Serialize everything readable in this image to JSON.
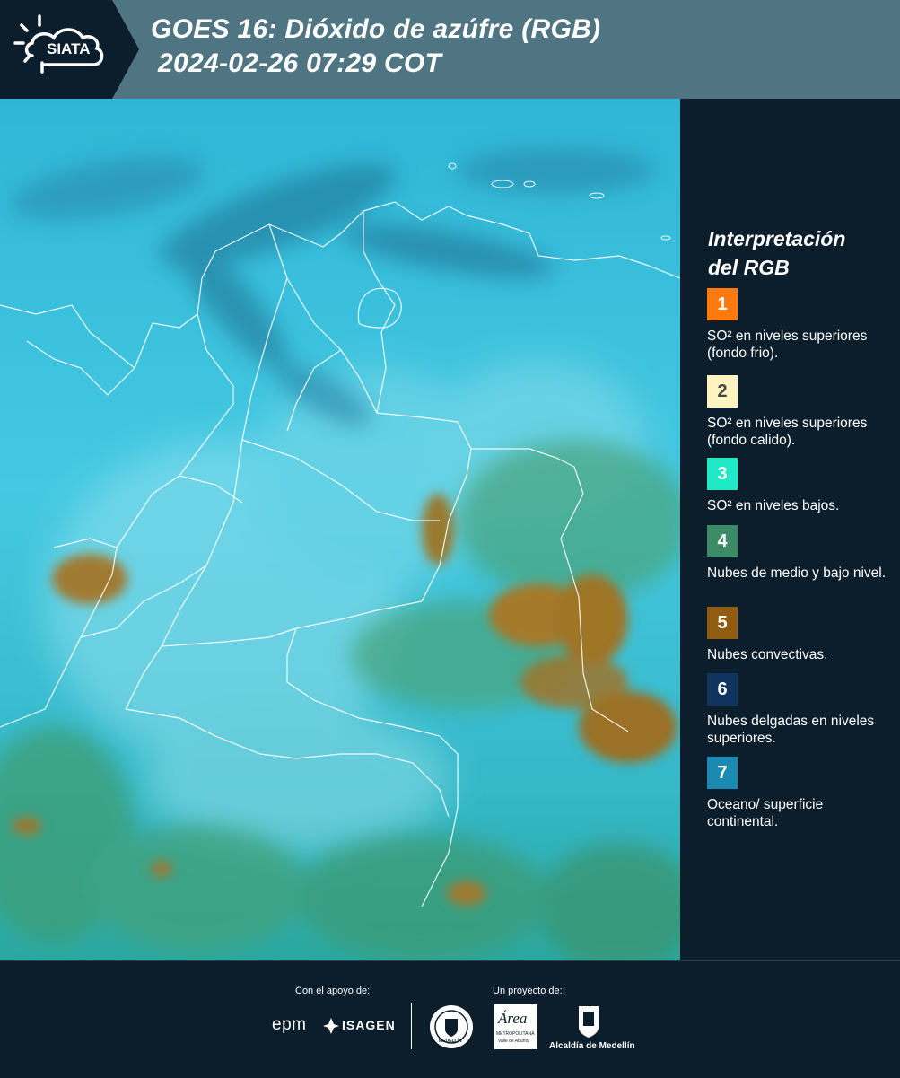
{
  "header": {
    "logo_text": "SIATA",
    "title_line1": "GOES 16: Dióxido de azúfre (RGB)",
    "title_line2": "2024-02-26 07:29 COT",
    "background": "#4f7482",
    "logo_background": "#0c1e2b"
  },
  "map": {
    "icon": "satellite-rgb-map",
    "colors": {
      "clear": "#33c3df",
      "thin": "#7cd9ea",
      "convective": "#a97b2a",
      "low_cloud": "#3f9a6e",
      "borders": "#ffffff"
    }
  },
  "legend": {
    "title_line1": "Interpretación",
    "title_line2": "del RGB",
    "items": [
      {
        "num": "1",
        "color": "#ff7a0e",
        "text_color": "#ffffff",
        "label": "SO² en niveles superiores (fondo frio)."
      },
      {
        "num": "2",
        "color": "#fff4c0",
        "text_color": "#444444",
        "label": "SO² en niveles superiores (fondo calido)."
      },
      {
        "num": "3",
        "color": "#1fe8c6",
        "text_color": "#ffffff",
        "label": "SO² en niveles bajos."
      },
      {
        "num": "4",
        "color": "#3a8b66",
        "text_color": "#ffffff",
        "label": "Nubes de medio y bajo nivel."
      },
      {
        "num": "5",
        "color": "#8f5c12",
        "text_color": "#ffffff",
        "label": "Nubes convectivas."
      },
      {
        "num": "6",
        "color": "#10335f",
        "text_color": "#ffffff",
        "label": "Nubes delgadas en niveles superiores."
      },
      {
        "num": "7",
        "color": "#1a8ab3",
        "text_color": "#ffffff",
        "label": "Oceano/ superficie continental."
      }
    ]
  },
  "footer": {
    "support_caption": "Con el apoyo de:",
    "project_caption": "Un proyecto de:",
    "epm_text": "epm",
    "isagen_text": "ISAGEN",
    "medellin_seal_text": "MEDELLÍN",
    "area_text": "Área",
    "area_sub": "METROPOLITANA",
    "area_sub2": "Valle de Aburrá",
    "alcaldia_text": "Alcaldía de Medellín"
  }
}
